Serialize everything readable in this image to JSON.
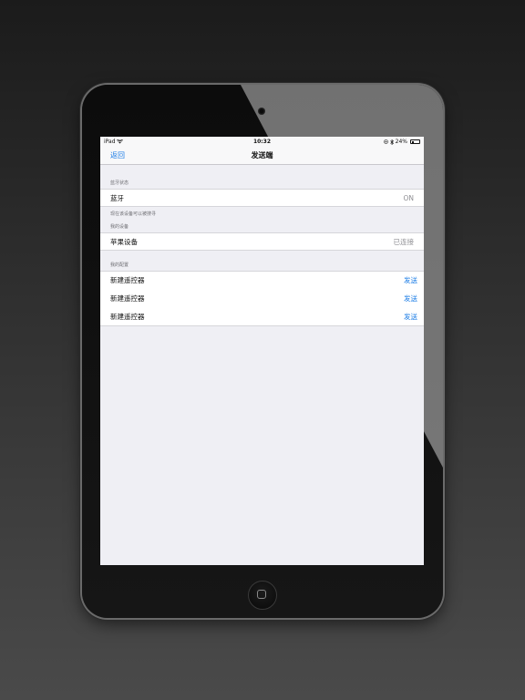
{
  "status_bar": {
    "device": "iPad",
    "time": "10:32",
    "battery_percent": "24%",
    "battery_level": 0.24
  },
  "nav": {
    "back_label": "返回",
    "title": "发送端"
  },
  "bluetooth_section": {
    "header": "蓝牙状态",
    "label": "蓝牙",
    "value": "ON",
    "footer": "现在该设备可以被搜寻"
  },
  "devices_section": {
    "header": "我的设备",
    "label": "苹果设备",
    "value": "已连接"
  },
  "configs_section": {
    "header": "我的配置",
    "items": [
      {
        "label": "新建遥控器",
        "action": "发送"
      },
      {
        "label": "新建遥控器",
        "action": "发送"
      },
      {
        "label": "新建遥控器",
        "action": "发送"
      }
    ]
  },
  "colors": {
    "accent": "#1a7ce6",
    "background": "#efeff4"
  },
  "icons": [
    "wifi-icon",
    "location-icon",
    "bluetooth-icon",
    "battery-icon",
    "home-button-icon"
  ]
}
